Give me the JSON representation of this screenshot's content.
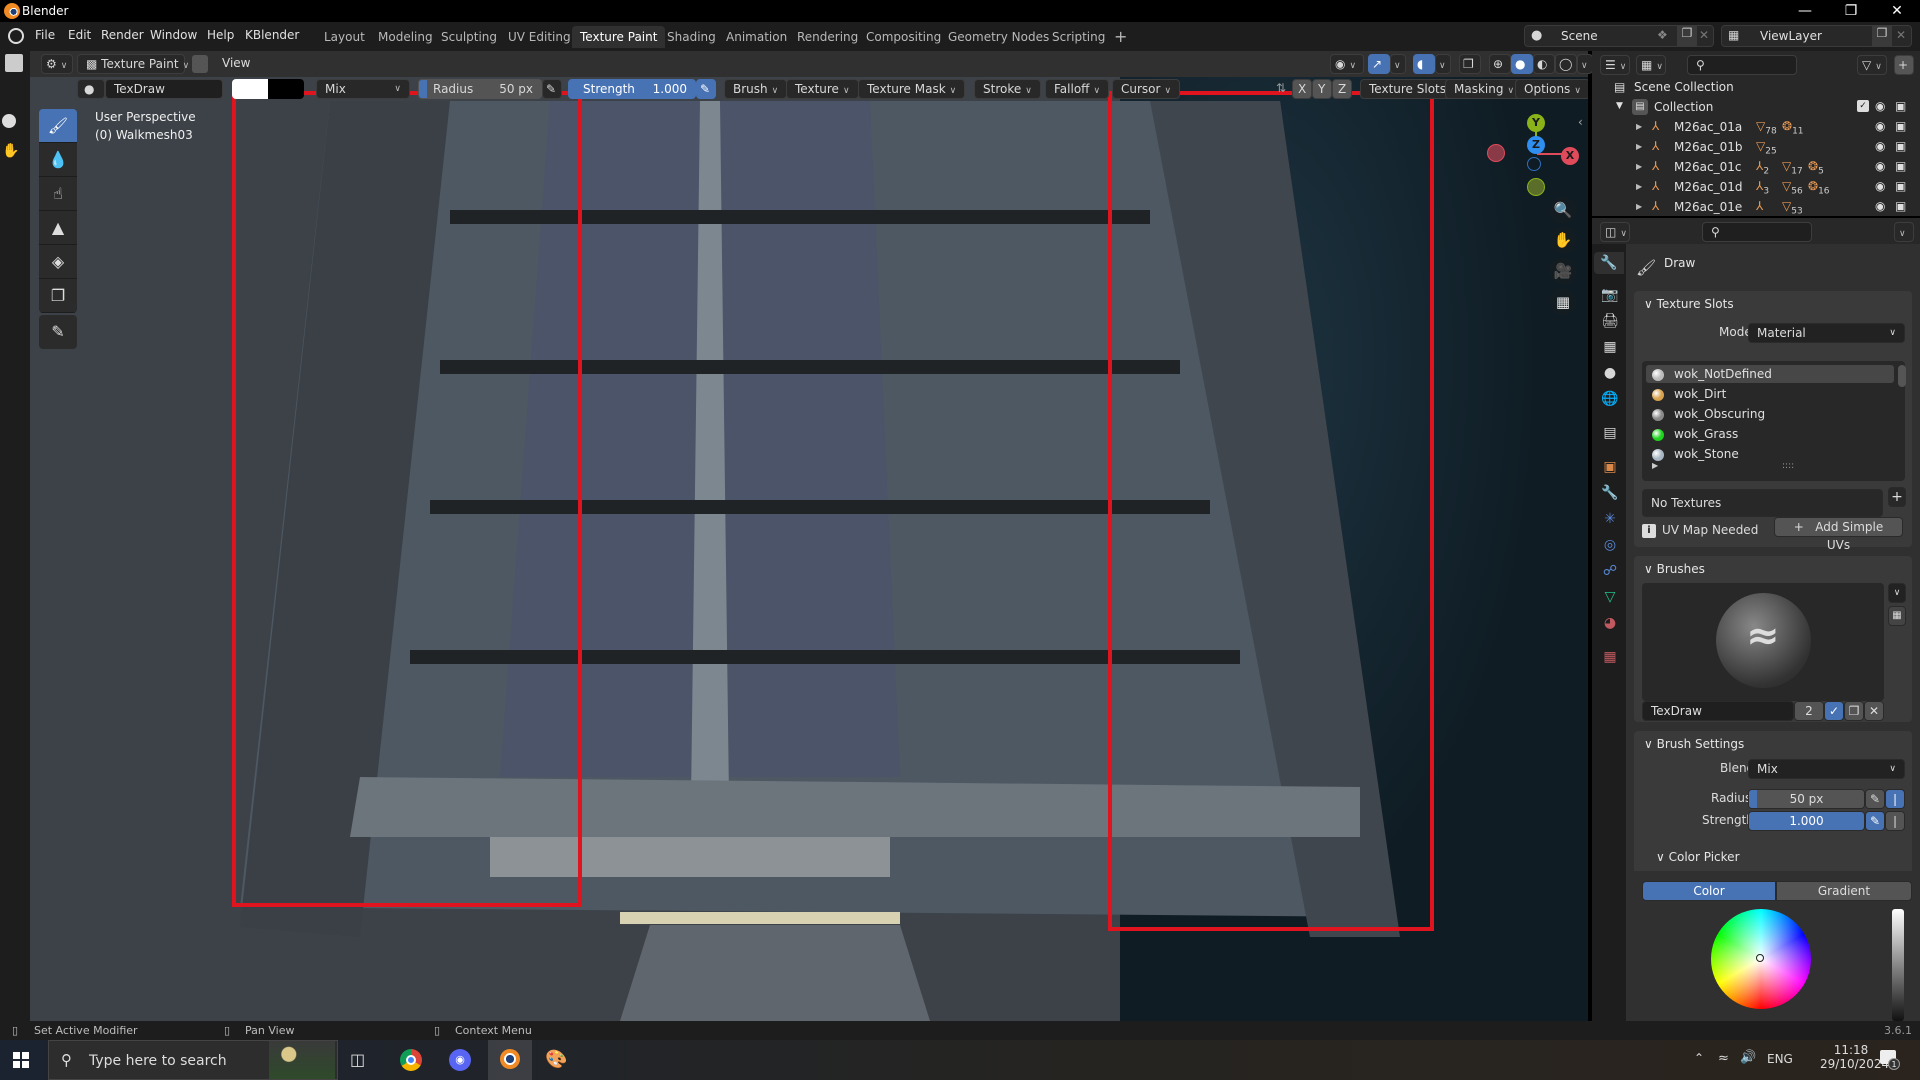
{
  "window": {
    "title": "Blender",
    "controls": [
      "minimize",
      "restore",
      "close"
    ]
  },
  "menubar": {
    "menus": [
      "File",
      "Edit",
      "Render",
      "Window",
      "Help",
      "KBlender"
    ],
    "workspaces": [
      "Layout",
      "Modeling",
      "Sculpting",
      "UV Editing",
      "Texture Paint",
      "Shading",
      "Animation",
      "Rendering",
      "Compositing",
      "Geometry Nodes",
      "Scripting"
    ],
    "active_workspace": "Texture Paint",
    "add_workspace": "+",
    "scene": "Scene",
    "view_layer": "ViewLayer"
  },
  "editor_header": {
    "mode": "Texture Paint",
    "view_menu": "View"
  },
  "tool_header": {
    "brush_name": "TexDraw",
    "blend": "Mix",
    "radius_label": "Radius",
    "radius_value": "50 px",
    "strength_label": "Strength",
    "strength_value": "1.000",
    "menus": [
      "Brush",
      "Texture",
      "Texture Mask",
      "Stroke",
      "Falloff",
      "Cursor"
    ],
    "symmetry": [
      "X",
      "Y",
      "Z"
    ],
    "right_menus": [
      "Texture Slots",
      "Masking",
      "Options"
    ]
  },
  "viewport": {
    "view_name": "User Perspective",
    "object_name": "(0) Walkmesh03",
    "gizmo_axes": [
      "Y",
      "Z",
      "X"
    ],
    "highlight_color": "#e0141e"
  },
  "tools": [
    "draw",
    "soften",
    "smear",
    "clone",
    "fill",
    "mask",
    "annotate"
  ],
  "active_tool": "draw",
  "outliner": {
    "root": "Scene Collection",
    "collection": "Collection",
    "items": [
      {
        "name": "M26ac_01a",
        "badges": [
          {
            "type": "mesh",
            "count": "78"
          },
          {
            "type": "light",
            "count": "11"
          }
        ]
      },
      {
        "name": "M26ac_01b",
        "badges": [
          {
            "type": "mesh",
            "count": "25"
          }
        ]
      },
      {
        "name": "M26ac_01c",
        "badges": [
          {
            "type": "empty",
            "count": "2"
          },
          {
            "type": "mesh",
            "count": "17"
          },
          {
            "type": "light",
            "count": "5"
          }
        ]
      },
      {
        "name": "M26ac_01d",
        "badges": [
          {
            "type": "empty",
            "count": "3"
          },
          {
            "type": "mesh",
            "count": "56"
          },
          {
            "type": "light",
            "count": "16"
          }
        ]
      },
      {
        "name": "M26ac_01e",
        "badges": [
          {
            "type": "empty",
            "count": ""
          },
          {
            "type": "mesh",
            "count": "53"
          }
        ]
      }
    ]
  },
  "properties": {
    "tool_name": "Draw",
    "texture_slots": {
      "title": "Texture Slots",
      "mode_label": "Mode",
      "mode_value": "Material",
      "materials": [
        {
          "name": "wok_NotDefined",
          "color": "#bcbcbc",
          "selected": true
        },
        {
          "name": "wok_Dirt",
          "color": "#d9a24e"
        },
        {
          "name": "wok_Obscuring",
          "color": "#8a8a8a"
        },
        {
          "name": "wok_Grass",
          "color": "#1ed41e"
        },
        {
          "name": "wok_Stone",
          "color": "#a9b6c4"
        }
      ],
      "no_textures": "No Textures",
      "uv_warning": "UV Map Needed",
      "add_uvs": "Add Simple UVs"
    },
    "brushes": {
      "title": "Brushes",
      "brush_name": "TexDraw",
      "users": "2"
    },
    "brush_settings": {
      "title": "Brush Settings",
      "blend_label": "Blend",
      "blend_value": "Mix",
      "radius_label": "Radius",
      "radius_value": "50 px",
      "strength_label": "Strength",
      "strength_value": "1.000"
    },
    "color_picker": {
      "title": "Color Picker",
      "tabs": [
        "Color",
        "Gradient"
      ],
      "active_tab": "Color",
      "value": 1.0
    }
  },
  "statusbar": {
    "left_hint": "Set Active Modifier",
    "middle_hint": "Pan View",
    "right_hint": "Context Menu",
    "version": "3.6.1"
  },
  "taskbar": {
    "search_placeholder": "Type here to search",
    "apps": [
      "task-view",
      "chrome",
      "discord",
      "blender",
      "paint"
    ],
    "tray_lang": "ENG",
    "time": "11:18",
    "date": "29/10/2024",
    "notifications": "1"
  }
}
